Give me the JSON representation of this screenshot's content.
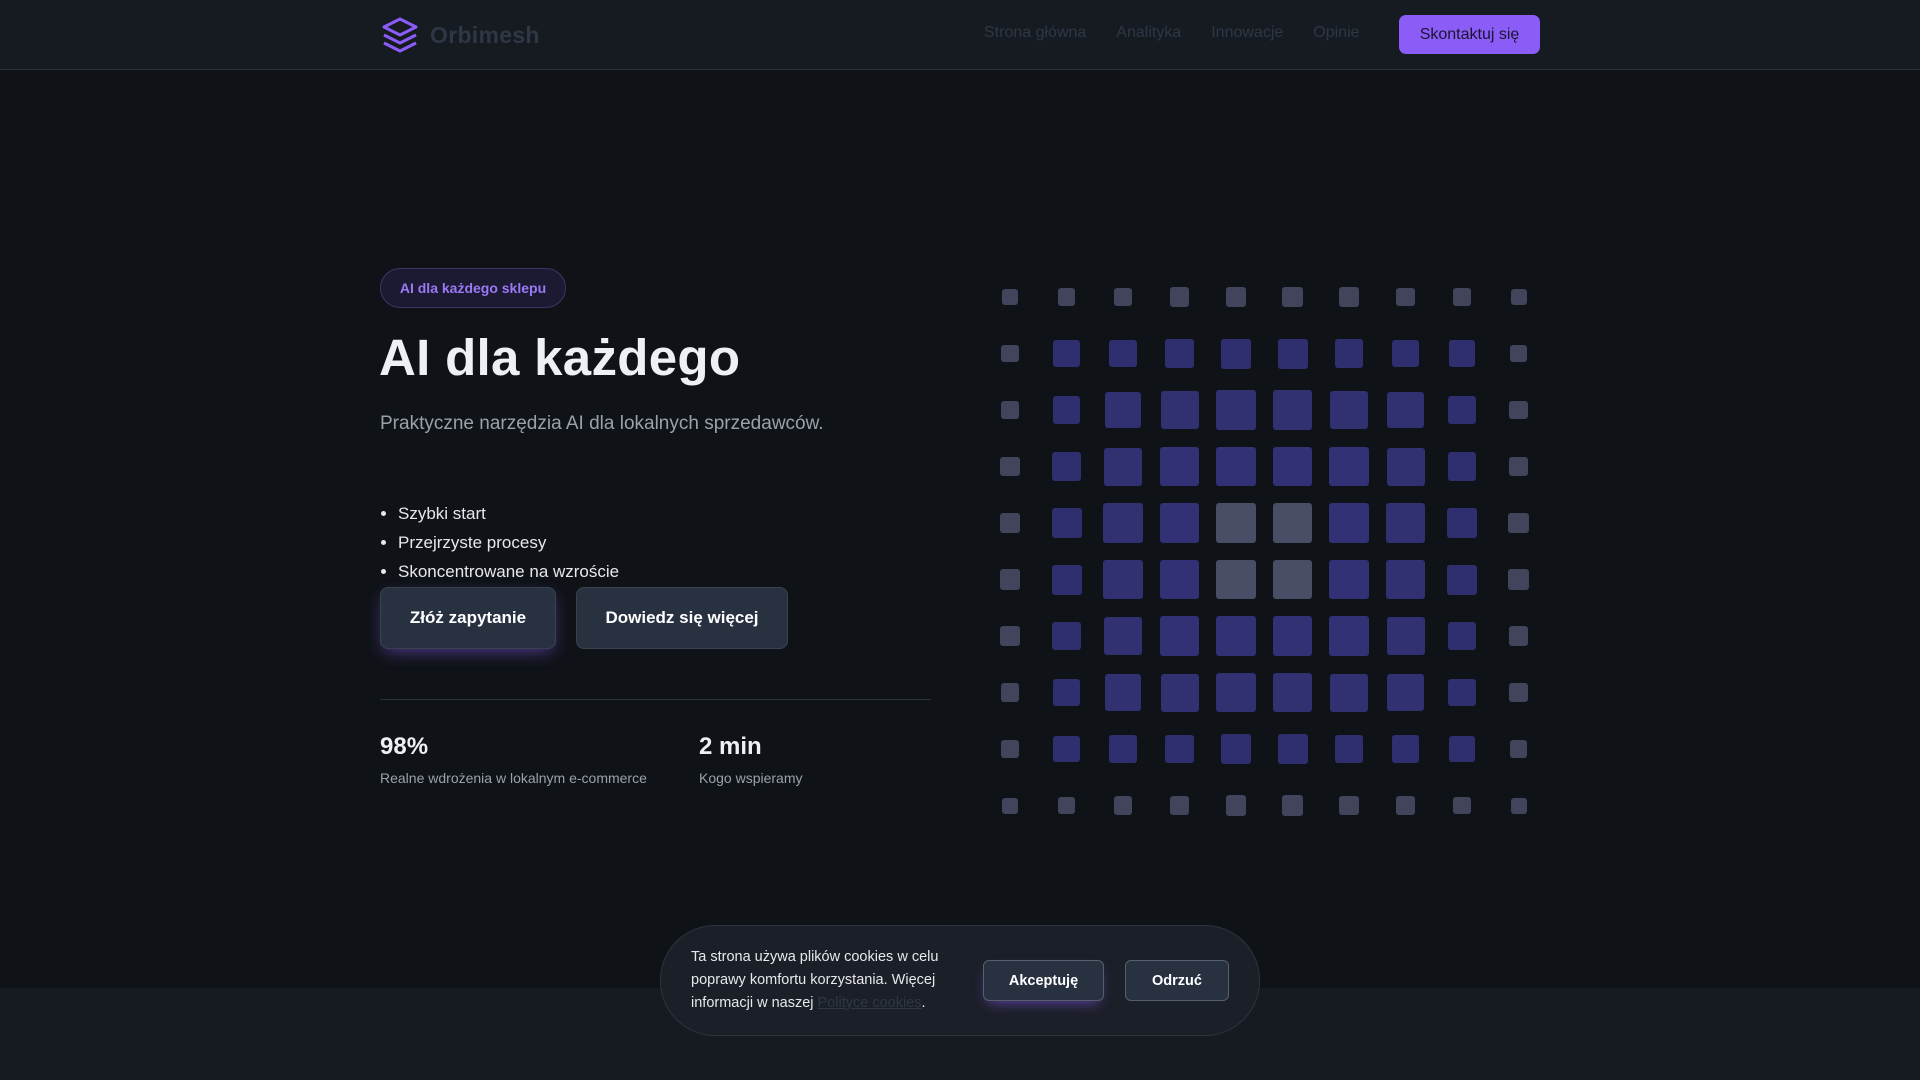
{
  "header": {
    "brand": "Orbimesh",
    "nav": [
      "Strona główna",
      "Analityka",
      "Innowacje",
      "Opinie"
    ],
    "cta_label": "Skontaktuj się"
  },
  "hero": {
    "badge": "AI dla każdego sklepu",
    "title": "AI dla każdego",
    "subtitle": "Praktyczne narzędzia AI dla lokalnych sprzedawców.",
    "features": [
      "Szybki start",
      "Przejrzyste procesy",
      "Skoncentrowane na wzroście"
    ],
    "primary_button": "Złóż zapytanie",
    "secondary_button": "Dowiedz się więcej"
  },
  "stats": [
    {
      "value": "98%",
      "label": "Realne wdrożenia w lokalnym e-commerce"
    },
    {
      "value": "2 min",
      "label": "Kogo wspieramy"
    }
  ],
  "cookie": {
    "text_before": "Ta strona używa plików cookies w celu poprawy komfortu korzystania. Więcej informacji w naszej",
    "link": "Polityce cookies",
    "text_after": ".",
    "accept": "Akceptuję",
    "reject": "Odrzuć"
  },
  "colors": {
    "accent": "#8b5cf6",
    "background": "#0f1318",
    "cell_indigo": "#34337a",
    "cell_gray": "#4a4d66"
  },
  "icons": {
    "logo": "layers-icon"
  }
}
